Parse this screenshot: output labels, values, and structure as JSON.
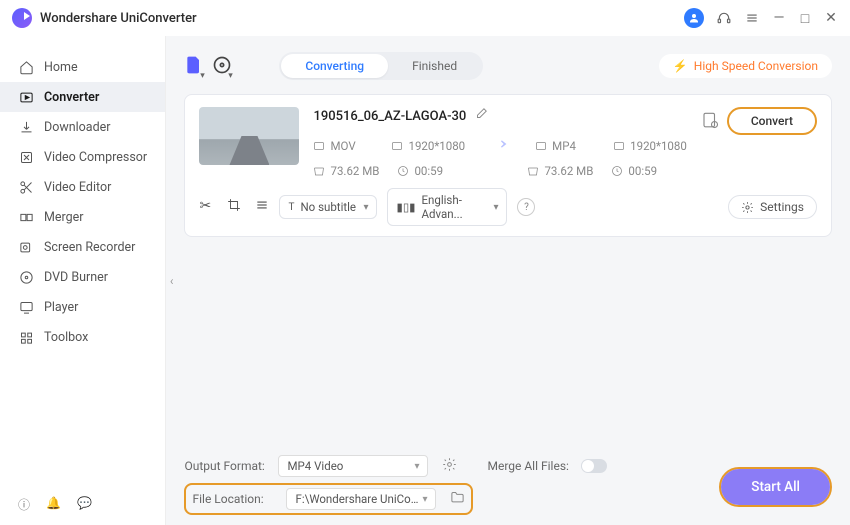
{
  "app_title": "Wondershare UniConverter",
  "titlebar": {
    "avatar_initial": ""
  },
  "sidebar": {
    "items": [
      {
        "label": "Home"
      },
      {
        "label": "Converter"
      },
      {
        "label": "Downloader"
      },
      {
        "label": "Video Compressor"
      },
      {
        "label": "Video Editor"
      },
      {
        "label": "Merger"
      },
      {
        "label": "Screen Recorder"
      },
      {
        "label": "DVD Burner"
      },
      {
        "label": "Player"
      },
      {
        "label": "Toolbox"
      }
    ]
  },
  "tabs": {
    "converting": "Converting",
    "finished": "Finished"
  },
  "high_speed_label": "High Speed Conversion",
  "file": {
    "title": "190516_06_AZ-LAGOA-30",
    "src_format": "MOV",
    "src_res": "1920*1080",
    "src_size": "73.62 MB",
    "src_dur": "00:59",
    "dst_format": "MP4",
    "dst_res": "1920*1080",
    "dst_size": "73.62 MB",
    "dst_dur": "00:59",
    "subtitle": "No subtitle",
    "audio": "English-Advan...",
    "convert_label": "Convert",
    "settings_label": "Settings"
  },
  "footer": {
    "output_format_label": "Output Format:",
    "output_format_value": "MP4 Video",
    "file_location_label": "File Location:",
    "file_location_value": "F:\\Wondershare UniConverter",
    "merge_label": "Merge All Files:",
    "start_all_label": "Start All"
  }
}
